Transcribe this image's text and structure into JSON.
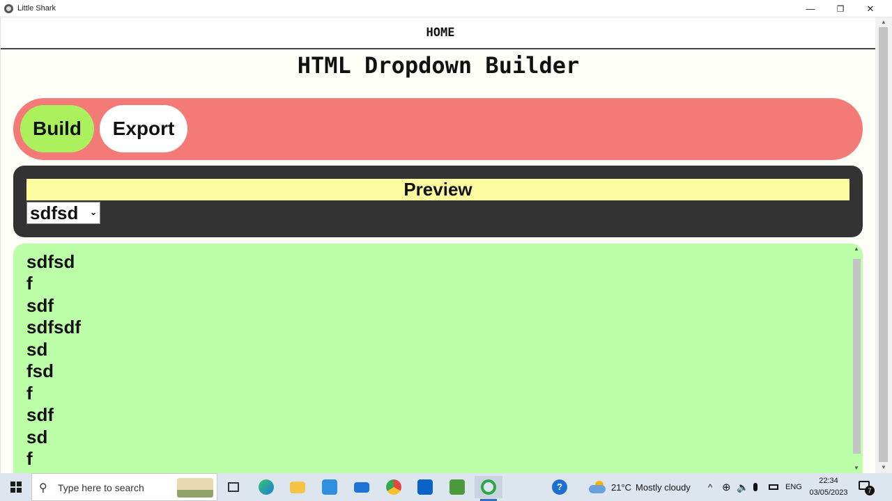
{
  "window": {
    "title": "Little Shark",
    "minimize": "—",
    "restore": "❐",
    "close": "✕"
  },
  "nav": {
    "home": "HOME"
  },
  "page": {
    "title": "HTML Dropdown Builder"
  },
  "tabs": {
    "build": "Build",
    "export": "Export"
  },
  "colors": {
    "tabbar": "#f47a78",
    "build_tab": "#abf05d",
    "preview_panel": "#333333",
    "preview_header": "#fdfba0",
    "options_area": "#bdfea9"
  },
  "preview": {
    "title": "Preview",
    "selected": "sdfsd",
    "chevron": "⌄"
  },
  "options": [
    "sdfsd",
    "f",
    "sdf",
    "sdfsdf",
    "sd",
    "fsd",
    "f",
    "sdf",
    "sd",
    "f"
  ],
  "taskbar": {
    "search_placeholder": "Type here to search",
    "search_icon": "⚲",
    "apps": [
      "task-view-icon",
      "edge-icon",
      "file-explorer-icon",
      "store-icon",
      "mail-icon",
      "chrome-icon",
      "outlook-icon",
      "editor-icon",
      "little-shark-icon"
    ],
    "help_icon": "?",
    "weather": {
      "temp": "21°C",
      "condition": "Mostly cloudy"
    },
    "tray_chevron": "^",
    "language": "ENG",
    "time": "22:34",
    "date": "03/05/2023",
    "notifications": "7"
  }
}
